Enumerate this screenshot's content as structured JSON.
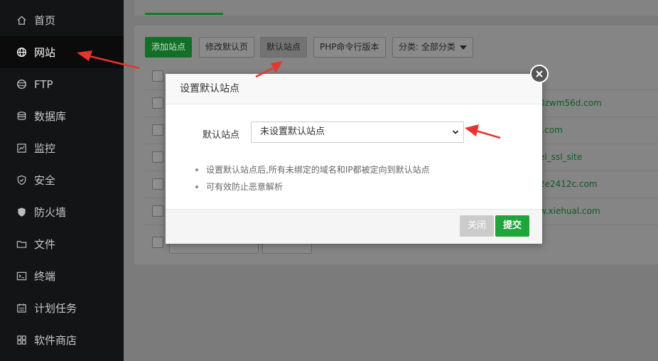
{
  "sidebar": {
    "items": [
      {
        "label": "首页",
        "icon": "home-icon"
      },
      {
        "label": "网站",
        "icon": "globe-icon"
      },
      {
        "label": "FTP",
        "icon": "ftp-icon"
      },
      {
        "label": "数据库",
        "icon": "database-icon"
      },
      {
        "label": "监控",
        "icon": "monitor-icon"
      },
      {
        "label": "安全",
        "icon": "shield-icon"
      },
      {
        "label": "防火墙",
        "icon": "firewall-icon"
      },
      {
        "label": "文件",
        "icon": "folder-icon"
      },
      {
        "label": "终端",
        "icon": "terminal-icon"
      },
      {
        "label": "计划任务",
        "icon": "calendar-icon"
      },
      {
        "label": "软件商店",
        "icon": "grid-icon"
      }
    ],
    "active": "网站"
  },
  "toolbar": {
    "add_site": "添加站点",
    "edit_default_page": "修改默认页",
    "default_site": "默认站点",
    "php_cli": "PHP命令行版本",
    "category": "分类: 全部分类"
  },
  "rows": [
    {
      "link": "0zwm56d.com"
    },
    {
      "link": "l.com"
    },
    {
      "link": "el_ssl_site"
    },
    {
      "link": "2e2412c.com"
    },
    {
      "link": "w.xiehual.com"
    }
  ],
  "modal": {
    "title": "设置默认站点",
    "field_label": "默认站点",
    "select_value": "未设置默认站点",
    "tips": [
      "设置默认站点后,所有未绑定的域名和IP都被定向到默认站点",
      "可有效防止恶意解析"
    ],
    "close_label": "关闭",
    "submit_label": "提交"
  },
  "colors": {
    "accent_green": "#20a53a",
    "annotation_red": "#e8342c"
  }
}
